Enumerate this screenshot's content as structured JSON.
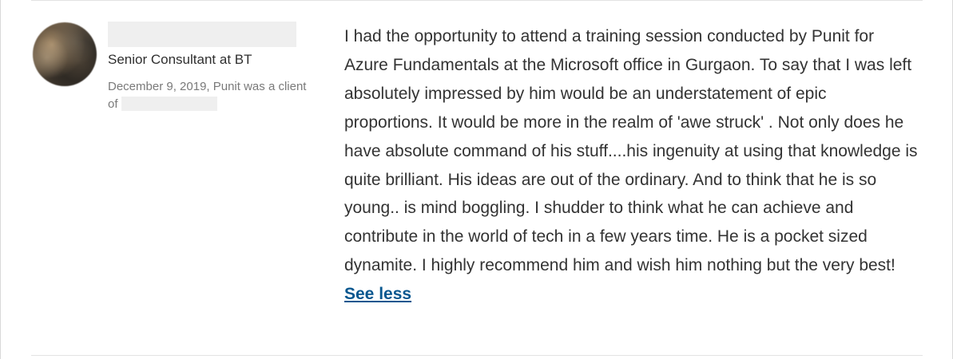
{
  "recommendation": {
    "recommender": {
      "headline": "Senior Consultant at BT",
      "date_relation_prefix": "December 9, 2019, Punit was a client of"
    },
    "body": "I had the opportunity to attend a training session conducted by Punit for Azure Fundamentals at the Microsoft office in Gurgaon. To say that I was left absolutely impressed by him would be an understatement of epic proportions. It would be more in the realm of 'awe struck' . Not only does he have absolute command of his stuff....his ingenuity at using that knowledge is quite brilliant. His ideas are out of the ordinary. And to think that he is so young.. is mind boggling. I shudder to think what he can achieve and contribute in the world of tech in a few years time. He is a pocket sized dynamite. I highly recommend him and wish him nothing but the very best!",
    "see_less_label": "See less"
  }
}
